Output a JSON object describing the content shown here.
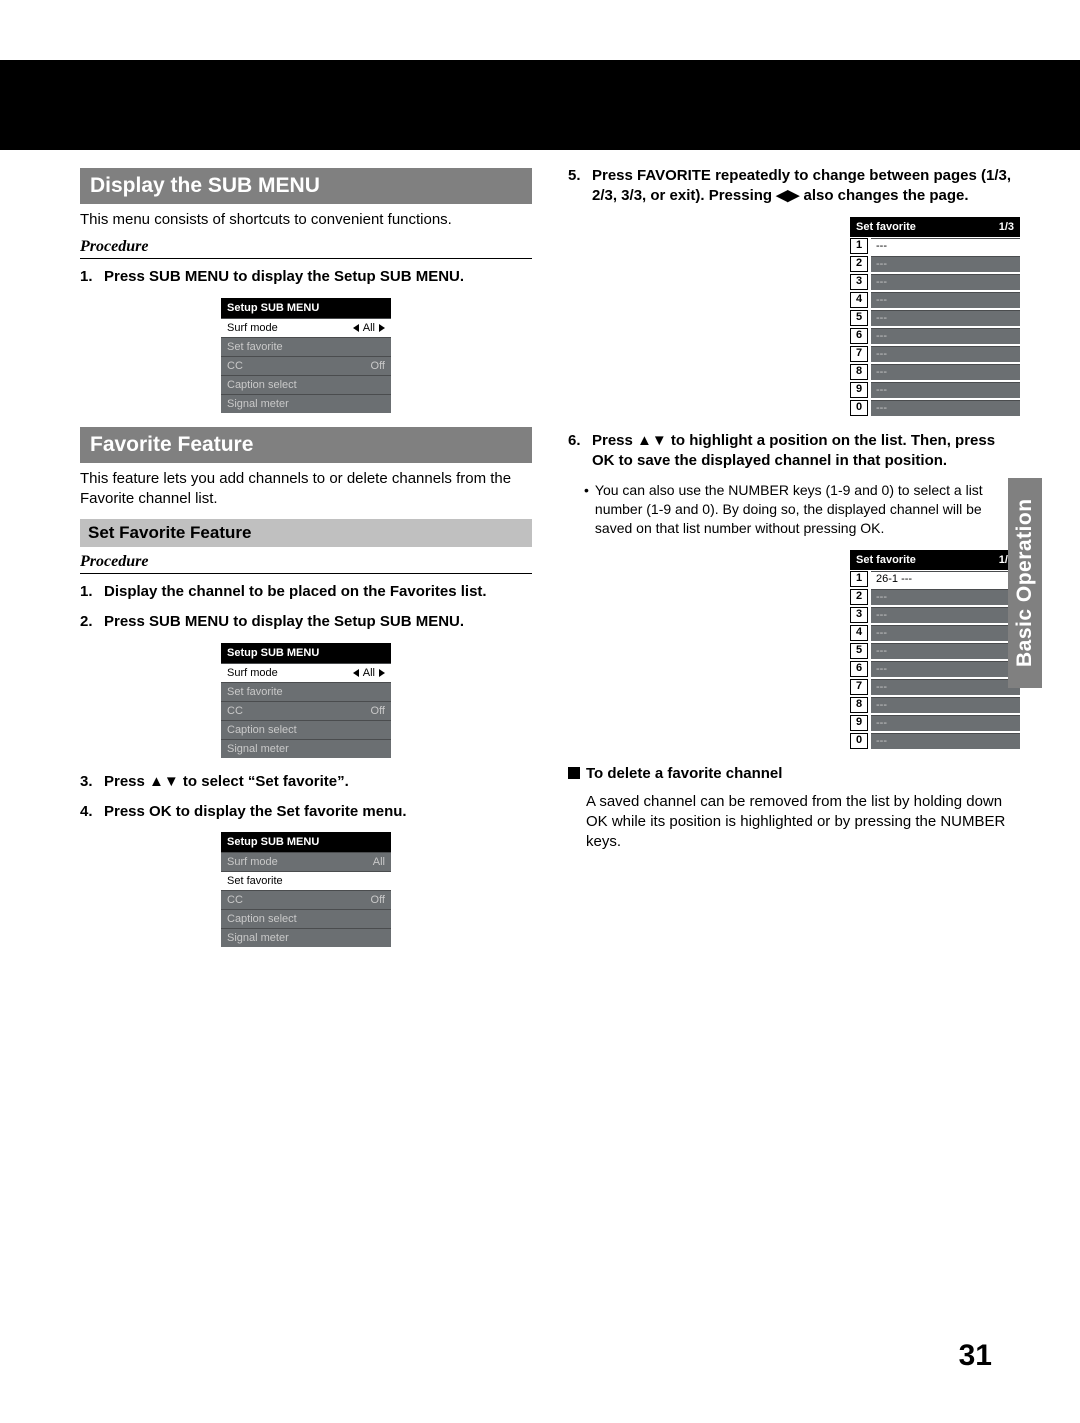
{
  "side_tab": "Basic Operation",
  "page_number": "31",
  "left": {
    "title1": "Display the SUB MENU",
    "intro1": "This menu consists of shortcuts to convenient functions.",
    "procedure": "Procedure",
    "step1": {
      "n": "1.",
      "t": "Press SUB MENU to display the Setup SUB MENU."
    },
    "title2": "Favorite Feature",
    "intro2": "This feature lets you add channels to or delete channels from the Favorite channel list.",
    "subtitle": "Set Favorite Feature",
    "step_a": {
      "n": "1.",
      "t": "Display the channel to be placed on the Favorites list."
    },
    "step_b": {
      "n": "2.",
      "t": "Press SUB MENU to display the Setup SUB MENU."
    },
    "step_c": {
      "n": "3.",
      "t": "Press ▲▼ to select “Set favorite”."
    },
    "step_d": {
      "n": "4.",
      "t": "Press OK to display the Set favorite menu."
    }
  },
  "right": {
    "step5": {
      "n": "5.",
      "t": "Press FAVORITE repeatedly to change between pages (1/3, 2/3, 3/3, or exit). Pressing ◀▶ also changes the page."
    },
    "step6": {
      "n": "6.",
      "t": "Press ▲▼ to highlight a position on the list. Then, press OK to save the displayed channel in that position."
    },
    "note": "You can also use the NUMBER keys (1-9 and 0) to select a list number (1-9 and 0). By doing so, the displayed channel will be saved on that list number without pressing OK.",
    "del_head": "To delete a favorite channel",
    "del_body": "A saved channel can be removed from the list by holding down OK while its position is highlighted or by pressing the NUMBER keys."
  },
  "osd": {
    "title": "Setup SUB MENU",
    "rows": [
      {
        "label": "Surf mode",
        "value": "All",
        "arrows": true
      },
      {
        "label": "Set favorite",
        "value": ""
      },
      {
        "label": "CC",
        "value": "Off"
      },
      {
        "label": "Caption select",
        "value": ""
      },
      {
        "label": "Signal meter",
        "value": ""
      }
    ]
  },
  "fav": {
    "title": "Set favorite",
    "page": "1/3",
    "nums": [
      "1",
      "2",
      "3",
      "4",
      "5",
      "6",
      "7",
      "8",
      "9",
      "0"
    ],
    "empty": "---",
    "entry": "26-1    ---"
  }
}
